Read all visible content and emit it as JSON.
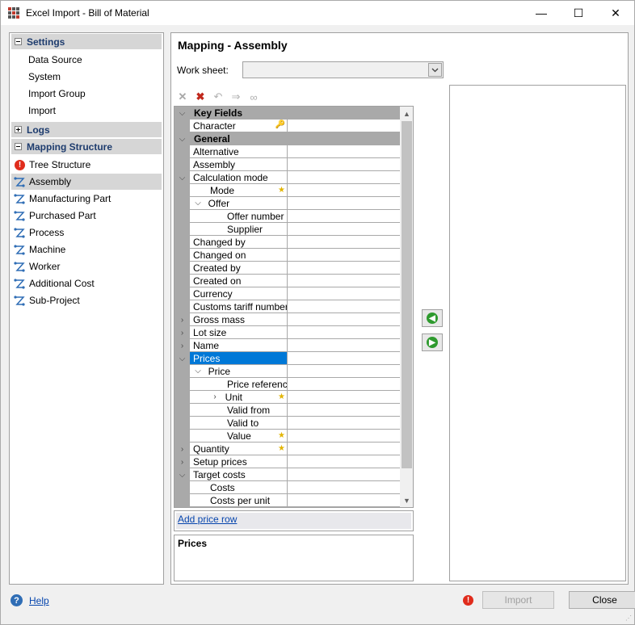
{
  "window": {
    "title": "Excel Import - Bill of Material",
    "min_glyph": "—",
    "max_glyph": "☐",
    "close_glyph": "✕"
  },
  "nav": {
    "groups": [
      {
        "label": "Settings",
        "expanded": true
      },
      {
        "label": "Logs",
        "expanded": false
      },
      {
        "label": "Mapping Structure",
        "expanded": true
      }
    ],
    "settings_items": [
      "Data Source",
      "System",
      "Import Group",
      "Import"
    ],
    "mapping_items": [
      {
        "label": "Tree Structure",
        "icon": "error-icon"
      },
      {
        "label": "Assembly",
        "icon": "structure-icon",
        "selected": true
      },
      {
        "label": "Manufacturing Part",
        "icon": "structure-icon"
      },
      {
        "label": "Purchased Part",
        "icon": "structure-icon"
      },
      {
        "label": "Process",
        "icon": "structure-icon"
      },
      {
        "label": "Machine",
        "icon": "structure-icon"
      },
      {
        "label": "Worker",
        "icon": "structure-icon"
      },
      {
        "label": "Additional Cost",
        "icon": "structure-icon"
      },
      {
        "label": "Sub-Project",
        "icon": "structure-icon"
      }
    ]
  },
  "main": {
    "title": "Mapping - Assembly",
    "worksheet_label": "Work sheet:",
    "worksheet_value": ""
  },
  "grid": {
    "categories": {
      "key_fields": "Key Fields",
      "general": "General"
    },
    "rows": {
      "character": "Character",
      "alternative": "Alternative",
      "assembly": "Assembly",
      "calculation_mode": "Calculation mode",
      "mode": "Mode",
      "offer": "Offer",
      "offer_number": "Offer number",
      "supplier": "Supplier",
      "changed_by": "Changed by",
      "changed_on": "Changed on",
      "created_by": "Created by",
      "created_on": "Created on",
      "currency": "Currency",
      "customs_tariff_number": "Customs tariff number",
      "gross_mass": "Gross mass",
      "lot_size": "Lot size",
      "name": "Name",
      "prices": "Prices",
      "price": "Price",
      "price_reference": "Price reference",
      "unit": "Unit",
      "valid_from": "Valid from",
      "valid_to": "Valid to",
      "value": "Value",
      "quantity": "Quantity",
      "setup_prices": "Setup prices",
      "target_costs": "Target costs",
      "costs": "Costs",
      "costs_per_unit": "Costs per unit"
    }
  },
  "add_price_row": "Add price row",
  "description_title": "Prices",
  "footer": {
    "help": "Help",
    "import": "Import",
    "close": "Close"
  },
  "colors": {
    "selection": "#0078d7",
    "category_bg": "#a9a9a9",
    "nav_header_text": "#1e3c6e",
    "star": "#e2b400",
    "error": "#e02c1c"
  }
}
